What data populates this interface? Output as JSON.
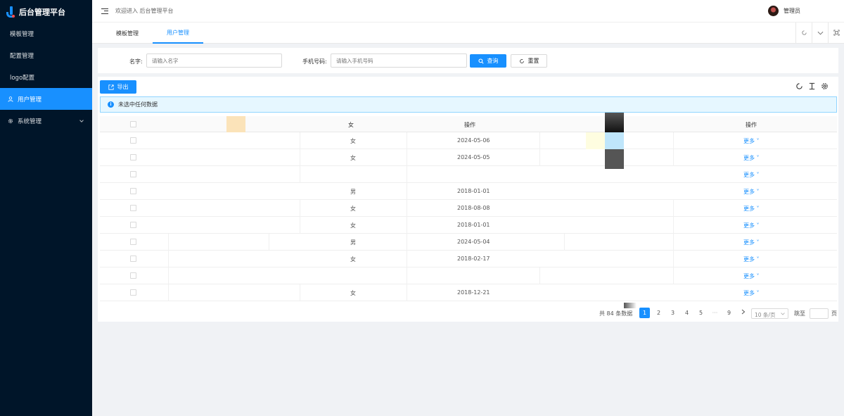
{
  "app": {
    "title": "后台管理平台"
  },
  "sidebar": {
    "items": [
      {
        "label": "模板管理"
      },
      {
        "label": "配置管理"
      },
      {
        "label": "logo配置"
      },
      {
        "label": "用户管理"
      },
      {
        "label": "系统管理"
      }
    ]
  },
  "header": {
    "welcome": "欢迎进入 后台管理平台",
    "user_name": "管理员"
  },
  "tabs": [
    {
      "label": "模板管理"
    },
    {
      "label": "用户管理"
    }
  ],
  "search": {
    "name_label": "名字:",
    "name_placeholder": "请输入名字",
    "phone_label": "手机号码:",
    "phone_placeholder": "请输入手机号码",
    "query_label": "查询",
    "reset_label": "重置"
  },
  "toolbar": {
    "export_label": "导出"
  },
  "alert": {
    "text": "未选中任何数据"
  },
  "table": {
    "headers": {
      "gender": "女",
      "date": "操作",
      "op": "操作"
    },
    "rows": [
      {
        "gender": "女",
        "date": "2024-05-06",
        "op": "更多"
      },
      {
        "gender": "女",
        "date": "2024-05-05",
        "op": "更多"
      },
      {
        "gender": "",
        "date": "",
        "op": "更多"
      },
      {
        "gender": "男",
        "date": "2018-01-01",
        "op": "更多"
      },
      {
        "gender": "女",
        "date": "2018-08-08",
        "op": "更多"
      },
      {
        "gender": "女",
        "date": "2018-01-01",
        "op": "更多"
      },
      {
        "gender": "男",
        "date": "2024-05-04",
        "op": "更多"
      },
      {
        "gender": "女",
        "date": "2018-02-17",
        "op": "更多"
      },
      {
        "gender": "",
        "date": "",
        "op": "更多"
      },
      {
        "gender": "女",
        "date": "2018-12-21",
        "op": "更多"
      }
    ]
  },
  "pagination": {
    "total": "共 84 条数据",
    "pages": [
      "1",
      "2",
      "3",
      "4",
      "5",
      "···",
      "9"
    ],
    "page_size": "10 条/页",
    "jump_label": "跳至",
    "page_unit": "页"
  }
}
